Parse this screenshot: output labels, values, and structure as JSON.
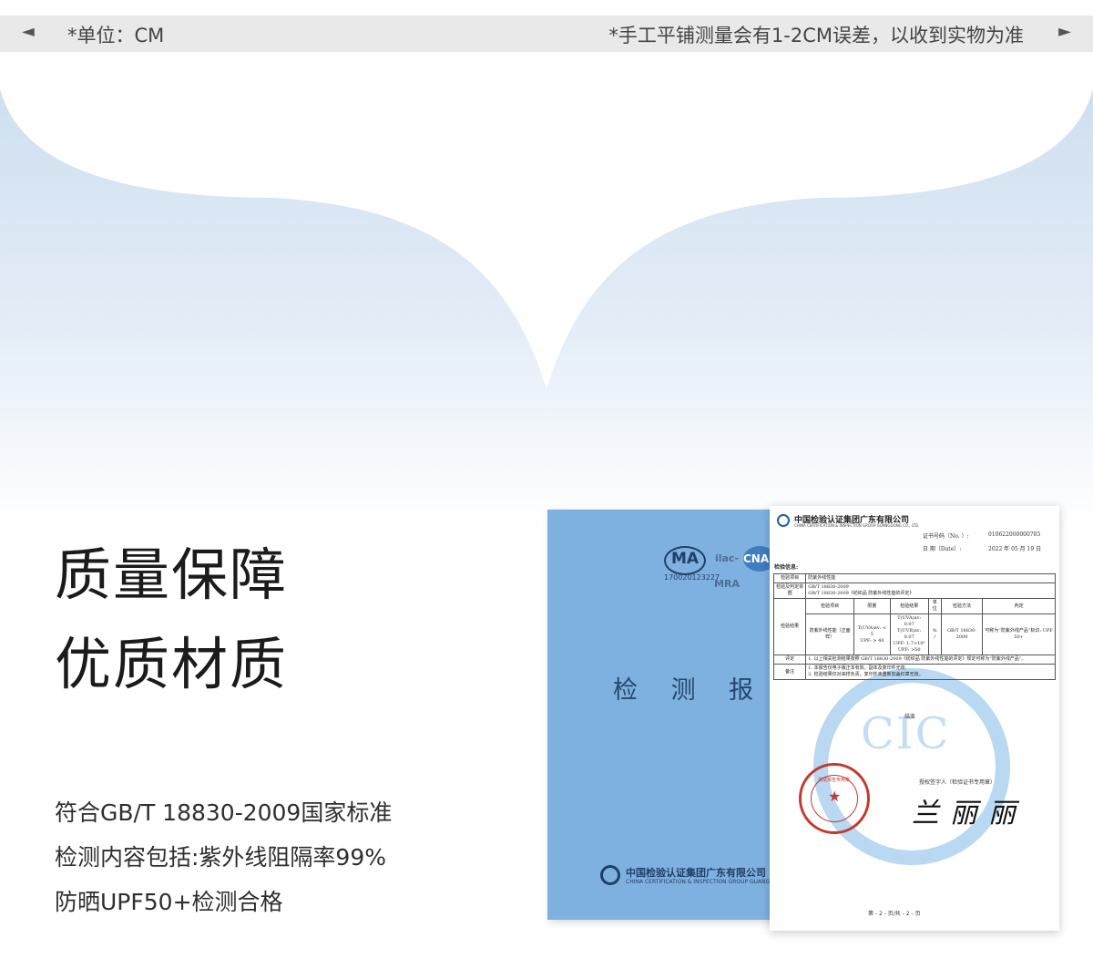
{
  "topbar": {
    "left_arrow": "◄",
    "unit": "*单位：CM",
    "note": "*手工平铺测量会有1-2CM误差，以收到实物为准",
    "right_arrow": "►"
  },
  "headline": {
    "line1": "质量保障",
    "line2": "优质材质"
  },
  "description": [
    "符合GB/T 18830-2009国家标准",
    "检测内容包括:紫外线阻隔率99%",
    "防晒UPF50+检测合格"
  ],
  "cover": {
    "title": "检 测 报 告",
    "badge_ma": "MA",
    "badge_ilac": "ilac-MRA",
    "badge_cnas": "CNAS",
    "reg_no": "170020123227",
    "company": "中国检验认证集团广东有限公司",
    "company_en": "CHINA CERTIFICATION & INSPECTION GROUP GUANGDONG CO., LTD."
  },
  "certificate": {
    "company": "中国检验认证集团广东有限公司",
    "company_en": "CHINA CERTIFICATION & INSPECTION GROUP GUANGDONG CO., LTD.",
    "cert_no_label": "证书号码（No. ）:",
    "cert_no": "010622000000785",
    "date_label": "日    期（Date）:",
    "date": "2022 年 05 月 19 日",
    "info_label": "检验信息:",
    "item_label": "检验项目",
    "item_value": "防紫外线性能",
    "basis_label": "检验及判定依据",
    "basis_value1": "GB/T 18830-2009",
    "basis_value2": "GB/T 18830-2009《纺织品 防紫外线性能的评定》",
    "result_label": "检验结果",
    "col_item": "检验项目",
    "col_limit": "限量",
    "col_result": "检验结果",
    "col_unit": "单位",
    "col_method": "检验方法",
    "col_verdict": "判定",
    "row_item": "防紫外线性能（正面样）",
    "row_limit1": "T(UVA)av: < 5",
    "row_limit2": "UPF: > 40",
    "row_result1": "T(UVA)av: 0.07",
    "row_result2": "T(UVB)av: 0.07",
    "row_result3": "UPF: 1.7×10³",
    "row_result4": "UPF: >50",
    "row_unit1": "%",
    "row_unit2": "/",
    "row_method": "GB/T 18830-2009",
    "row_verdict": "可称为“防紫外线产品”标识: UPF 50+",
    "comment_label": "评定",
    "comment_value": "1. 以上相关检测结果按照 GB/T 18830-2009《纺织品 防紫外线性能的评定》规定可称为“防紫外线产品”。",
    "remark_label": "备注",
    "remark_value1": "1. 本报告仅电子版正本有效，副本及复印件无效;",
    "remark_value2": "2. 检验结果仅对来样负责，复印件未重新加盖红章无效。",
    "end": "结束",
    "watermark": "CIC",
    "seal_text": "测试报告专用章",
    "signer_label": "授权签字人（检验证书专用章）",
    "signature": "兰丽丽",
    "page": "第 - 2 - 页/共 - 2 - 页"
  },
  "colors": {
    "cover_blue": "#7fb1e0",
    "seal_red": "#c23a2e",
    "bg_blue": "#dbe8f5"
  }
}
